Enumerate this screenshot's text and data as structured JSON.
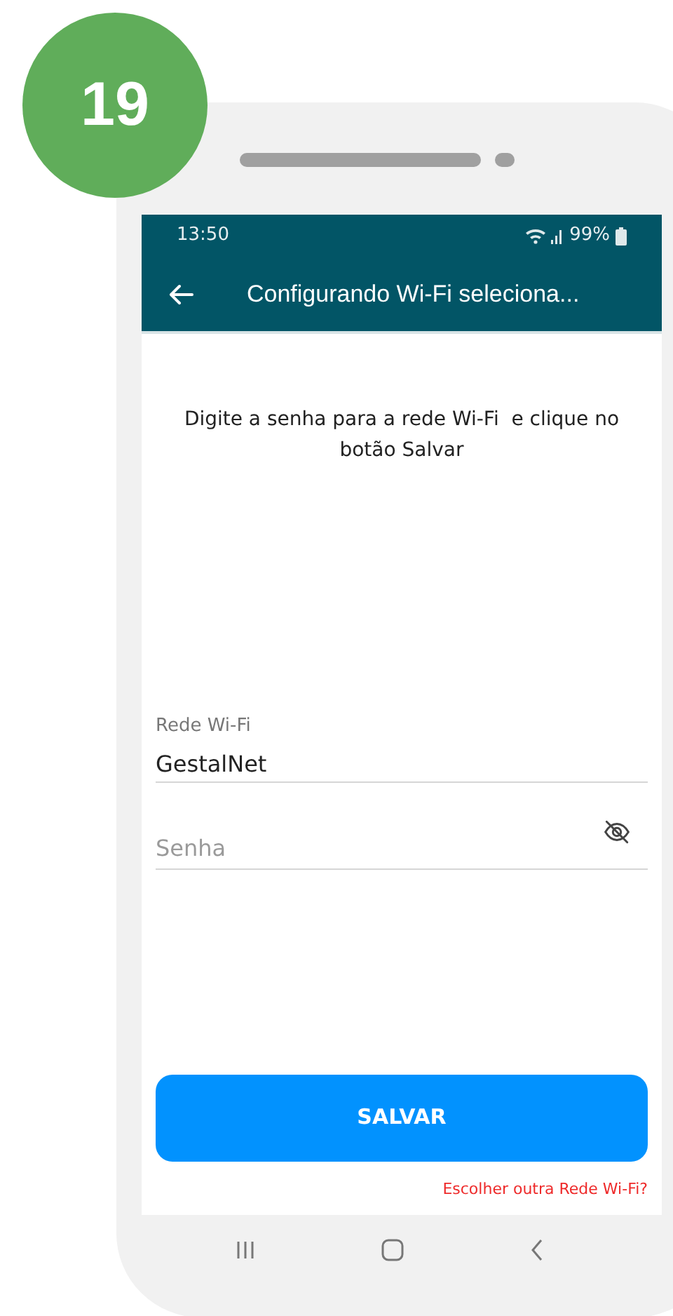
{
  "step_badge": "19",
  "status_bar": {
    "time": "13:50",
    "battery": "99%"
  },
  "app_bar": {
    "title": "Configurando Wi-Fi seleciona..."
  },
  "instruction": "Digite a senha para a rede Wi-Fi  e clique no botão Salvar",
  "fields": [
    {
      "kind": "text",
      "label": "Rede Wi-Fi",
      "value": "GestalNet"
    },
    {
      "kind": "password",
      "placeholder": "Senha"
    }
  ],
  "save_button": "SALVAR",
  "other_network_link": "Escolher outra Rede Wi-Fi?"
}
